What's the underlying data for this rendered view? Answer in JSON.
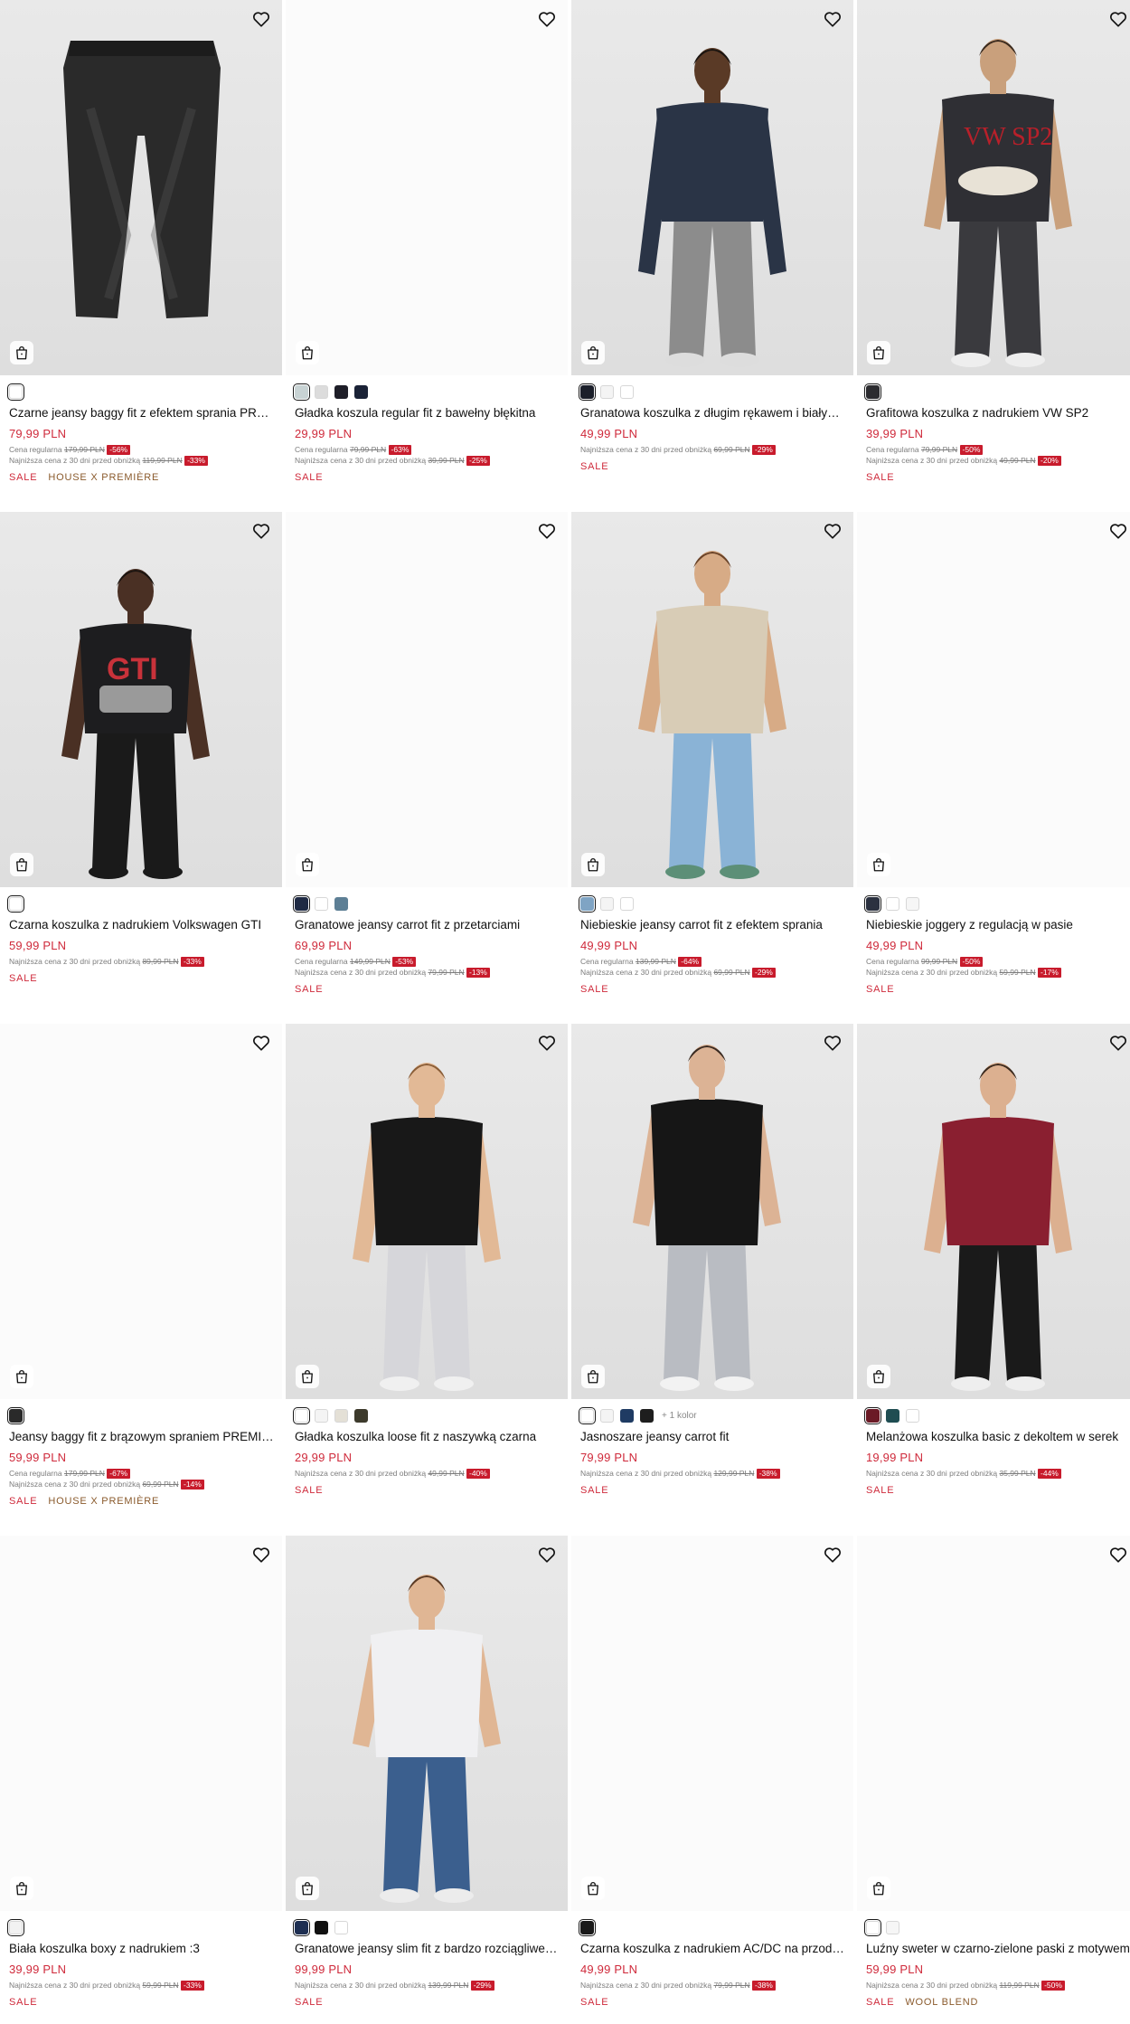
{
  "labels": {
    "regular_price": "Cena regularna",
    "lowest_price": "Najniższa cena z 30 dni przed obniżką",
    "more_colors": "+ 1 kolor"
  },
  "colors": {
    "price_red": "#cf2a3b",
    "discount_badge": "#c81b2c",
    "brand_tag": "#8a5a2c"
  },
  "products": [
    {
      "name": "Czarne jeansy baggy fit z efektem sprania PREMIÈRE",
      "image": "black-baggy-jeans",
      "swatches": [
        "#ffffff"
      ],
      "price": "79,99 PLN",
      "regular": "179,99 PLN",
      "regular_disc": "-56%",
      "lowest": "119,99 PLN",
      "lowest_disc": "-33%",
      "tags": [
        "SALE",
        "HOUSE X PREMIÈRE"
      ]
    },
    {
      "name": "Gładka koszula regular fit z bawełny błękitna",
      "image": "none",
      "swatches": [
        "#c8d3d4",
        "#dcdcdc",
        "#1e1e28",
        "#1a2236"
      ],
      "price": "29,99 PLN",
      "regular": "79,99 PLN",
      "regular_disc": "-63%",
      "lowest": "39,99 PLN",
      "lowest_disc": "-25%",
      "tags": [
        "SALE"
      ]
    },
    {
      "name": "Granatowa koszulka z długim rękawem i białymi wstawkami",
      "image": "navy-longsleeve",
      "swatches": [
        "#1b1f2a",
        "#f4f4f4",
        "#ffffff"
      ],
      "price": "49,99 PLN",
      "lowest": "69,99 PLN",
      "lowest_disc": "-29%",
      "tags": [
        "SALE"
      ]
    },
    {
      "name": "Grafitowa koszulka z nadrukiem VW SP2",
      "image": "graphite-tee-vw-sp2",
      "swatches": [
        "#2c2c30"
      ],
      "price": "39,99 PLN",
      "regular": "79,99 PLN",
      "regular_disc": "-50%",
      "lowest": "49,99 PLN",
      "lowest_disc": "-20%",
      "tags": [
        "SALE"
      ]
    },
    {
      "name": "Czarna koszulka z nadrukiem Volkswagen GTI",
      "image": "black-tee-gti",
      "swatches": [
        "#ffffff"
      ],
      "price": "59,99 PLN",
      "lowest": "89,99 PLN",
      "lowest_disc": "-33%",
      "tags": [
        "SALE"
      ]
    },
    {
      "name": "Granatowe jeansy carrot fit z przetarciami",
      "image": "none",
      "swatches": [
        "#1f2a44",
        "#ffffff",
        "#5d7f95"
      ],
      "price": "69,99 PLN",
      "regular": "149,99 PLN",
      "regular_disc": "-53%",
      "lowest": "79,99 PLN",
      "lowest_disc": "-13%",
      "tags": [
        "SALE"
      ]
    },
    {
      "name": "Niebieskie jeansy carrot fit z efektem sprania",
      "image": "blue-carrot-jeans",
      "swatches": [
        "#7fa4c4",
        "#f4f4f4",
        "#ffffff"
      ],
      "price": "49,99 PLN",
      "regular": "139,99 PLN",
      "regular_disc": "-64%",
      "lowest": "69,99 PLN",
      "lowest_disc": "-29%",
      "tags": [
        "SALE"
      ]
    },
    {
      "name": "Niebieskie joggery z regulacją w pasie",
      "image": "none",
      "swatches": [
        "#2b3140",
        "#ffffff",
        "#f6f6f6"
      ],
      "price": "49,99 PLN",
      "regular": "99,99 PLN",
      "regular_disc": "-50%",
      "lowest": "59,99 PLN",
      "lowest_disc": "-17%",
      "tags": [
        "SALE"
      ]
    },
    {
      "name": "Jeansy baggy fit z brązowym spraniem PREMIÈRE",
      "image": "none",
      "swatches": [
        "#2a2a2a"
      ],
      "price": "59,99 PLN",
      "regular": "179,99 PLN",
      "regular_disc": "-67%",
      "lowest": "69,99 PLN",
      "lowest_disc": "-14%",
      "tags": [
        "SALE",
        "HOUSE X PREMIÈRE"
      ]
    },
    {
      "name": "Gładka koszulka loose fit z naszywką czarna",
      "image": "black-loose-tee",
      "swatches": [
        "#ffffff",
        "#f4f4f4",
        "#e4e0d6",
        "#3d3a2c"
      ],
      "price": "29,99 PLN",
      "lowest": "49,99 PLN",
      "lowest_disc": "-40%",
      "tags": [
        "SALE"
      ]
    },
    {
      "name": "Jasnoszare jeansy carrot fit",
      "image": "lightgrey-carrot-jeans",
      "swatches": [
        "#ffffff",
        "#f4f4f4",
        "#1f3b63",
        "#1e1e1e"
      ],
      "more": true,
      "price": "79,99 PLN",
      "lowest": "129,99 PLN",
      "lowest_disc": "-38%",
      "tags": [
        "SALE"
      ]
    },
    {
      "name": "Melanżowa koszulka basic z dekoltem w serek",
      "image": "burgundy-vneck-tee",
      "swatches": [
        "#6b1a26",
        "#1f4d52",
        "#ffffff"
      ],
      "price": "19,99 PLN",
      "lowest": "35,99 PLN",
      "lowest_disc": "-44%",
      "tags": [
        "SALE"
      ]
    },
    {
      "name": "Biała koszulka boxy z nadrukiem :3",
      "image": "none",
      "swatches": [
        "#f2f2f2"
      ],
      "price": "39,99 PLN",
      "lowest": "59,99 PLN",
      "lowest_disc": "-33%",
      "tags": [
        "SALE"
      ]
    },
    {
      "name": "Granatowe jeansy slim fit z bardzo rozciągliwego denimu",
      "image": "navy-slim-jeans",
      "swatches": [
        "#1e2f52",
        "#111111",
        "#ffffff"
      ],
      "price": "99,99 PLN",
      "lowest": "139,99 PLN",
      "lowest_disc": "-29%",
      "tags": [
        "SALE"
      ]
    },
    {
      "name": "Czarna koszulka z nadrukiem AC/DC na przodzie i plecach",
      "image": "none",
      "swatches": [
        "#1a1a1a"
      ],
      "price": "49,99 PLN",
      "lowest": "79,99 PLN",
      "lowest_disc": "-38%",
      "tags": [
        "SALE"
      ]
    },
    {
      "name": "Luźny sweter w czarno-zielone paski z motywem",
      "image": "none",
      "swatches": [
        "#ffffff",
        "#f6f6f6"
      ],
      "price": "59,99 PLN",
      "lowest": "119,99 PLN",
      "lowest_disc": "-50%",
      "tags": [
        "SALE",
        "WOOL BLEND"
      ]
    }
  ]
}
